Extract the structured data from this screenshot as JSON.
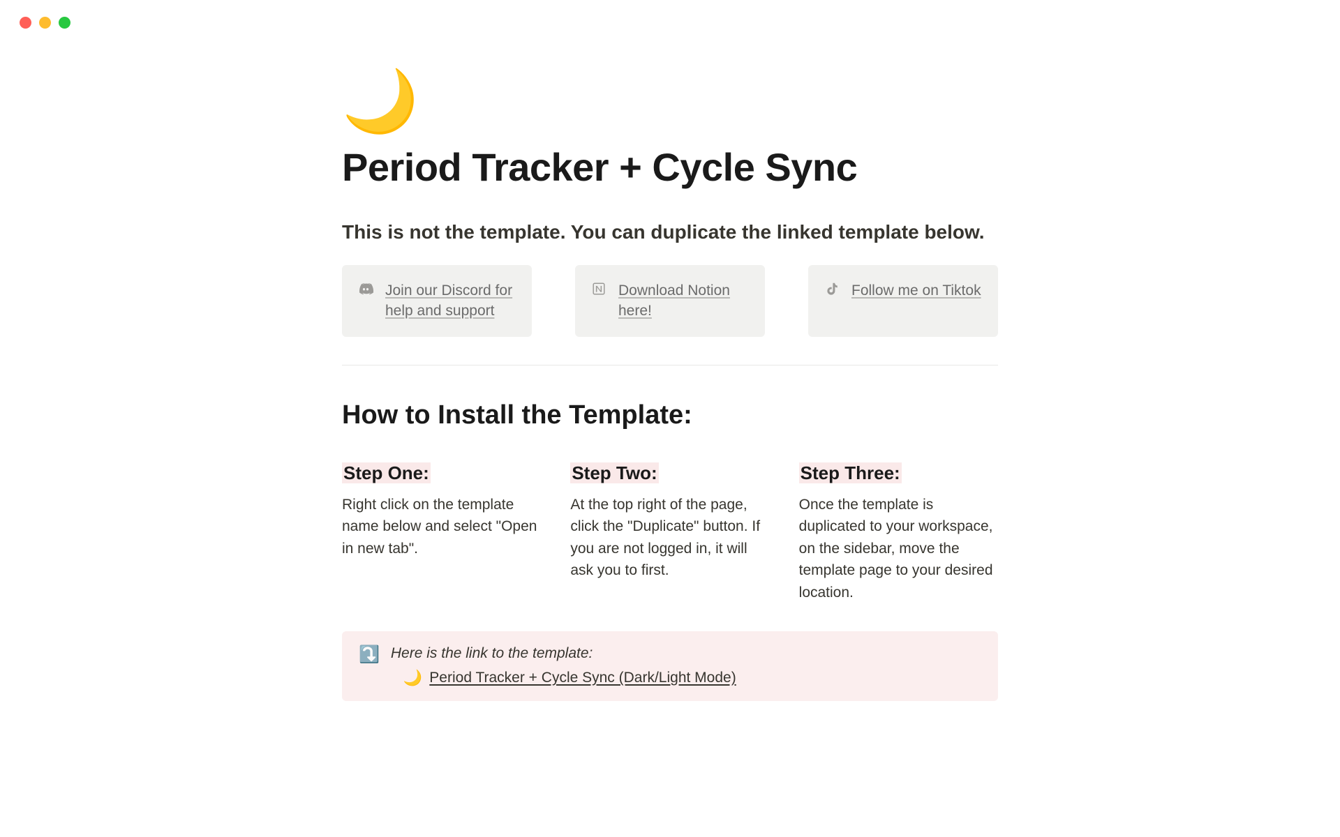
{
  "icon": "🌙",
  "title": "Period Tracker + Cycle Sync",
  "subtitle": "This is not the template. You can duplicate the linked template below.",
  "callouts": [
    {
      "icon": "discord",
      "text": "Join our Discord for help and support"
    },
    {
      "icon": "notion",
      "text": "Download Notion here!"
    },
    {
      "icon": "tiktok",
      "text": "Follow me on Tiktok"
    }
  ],
  "install_title": "How to Install the Template:",
  "steps": [
    {
      "heading": "Step One:",
      "body": "Right click on the template name below and select \"Open in new tab\"."
    },
    {
      "heading": "Step Two:",
      "body": "At the top right of the page, click the \"Duplicate\" button. If you are not logged in, it will ask you to first."
    },
    {
      "heading": "Step Three:",
      "body": "Once the template is duplicated to your workspace, on the sidebar, move the template page to your desired location."
    }
  ],
  "template_callout": {
    "icon": "⤵️",
    "intro": "Here is the link to the template:",
    "link_icon": "🌙",
    "link_text": "Period Tracker + Cycle Sync (Dark/Light Mode)"
  }
}
